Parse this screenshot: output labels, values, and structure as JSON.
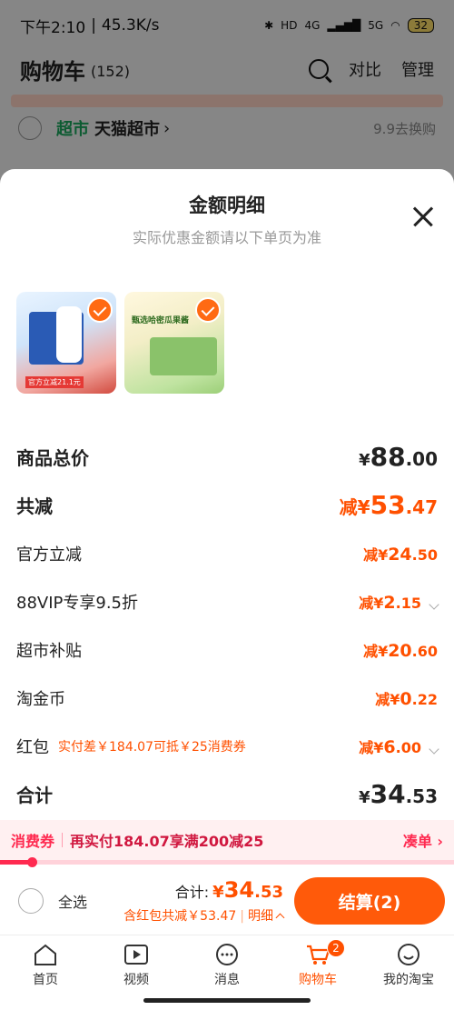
{
  "status_bar": {
    "time": "下午2:10",
    "speed": "45.3K/s",
    "battery": "32",
    "net1": "4G",
    "net2": "5G",
    "hd": "HD"
  },
  "cart": {
    "title": "购物车",
    "count": "(152)",
    "compare": "对比",
    "manage": "管理",
    "store_tag": "超市",
    "store_name": "天猫超市",
    "store_right": "9.9去换购"
  },
  "sheet": {
    "title": "金额明细",
    "subtitle": "实际优惠金额请以下单页为准",
    "products": [
      {
        "name": "product-yogurt",
        "caption": "官方立减21.1元"
      },
      {
        "name": "product-melon-jam",
        "caption": "甄选哈密瓜果酱"
      }
    ],
    "rows": {
      "subtotal_label": "商品总价",
      "subtotal_sym": "¥",
      "subtotal_int": "88",
      "subtotal_dec": ".00",
      "total_discount_label": "共减",
      "total_discount_pfx": "减¥",
      "total_discount_int": "53",
      "total_discount_dec": ".47",
      "official_label": "官方立减",
      "official_pfx": "减¥",
      "official_int": "24",
      "official_dec": ".50",
      "vip_label": "88VIP专享9.5折",
      "vip_pfx": "减¥",
      "vip_int": "2",
      "vip_dec": ".15",
      "market_label": "超市补贴",
      "market_pfx": "减¥",
      "market_int": "20",
      "market_dec": ".60",
      "coin_label": "淘金币",
      "coin_pfx": "减¥",
      "coin_int": "0",
      "coin_dec": ".22",
      "redpacket_label": "红包",
      "redpacket_note": "实付差￥184.07可抵￥25消费券",
      "redpacket_pfx": "减¥",
      "redpacket_int": "6",
      "redpacket_dec": ".00",
      "total_label": "合计",
      "total_sym": "¥",
      "total_int": "34",
      "total_dec": ".53"
    }
  },
  "promo": {
    "tag": "消费券",
    "text": "再实付184.07享满200减25",
    "action": "凑单",
    "progress": 0.07
  },
  "checkout": {
    "select_all": "全选",
    "sum_label": "合计:",
    "sum_sym": "¥",
    "sum_int": "34",
    "sum_dec": ".53",
    "sum_sub": "含红包共减￥53.47",
    "detail": "明细",
    "button": "结算(2)"
  },
  "tabbar": {
    "items": [
      {
        "label": "首页"
      },
      {
        "label": "视频"
      },
      {
        "label": "消息"
      },
      {
        "label": "购物车"
      },
      {
        "label": "我的淘宝"
      }
    ],
    "cart_badge": "2"
  },
  "colors": {
    "accent": "#ff5000",
    "promo_red": "#ff2a50"
  }
}
